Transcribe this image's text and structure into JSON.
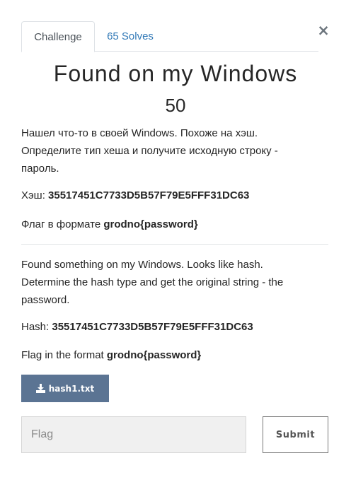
{
  "tabs": {
    "challenge": "Challenge",
    "solves": "65 Solves"
  },
  "close_glyph": "×",
  "challenge": {
    "title": "Found on my Windows",
    "value": "50"
  },
  "description_ru": {
    "text": "Нашел что-то в своей Windows. Похоже на хэш. Определите тип хеша и получите исходную строку - пароль.",
    "hash_label": "Хэш: ",
    "hash_value": "35517451C7733D5B57F79E5FFF31DC63",
    "flag_label": "Флаг в формате ",
    "flag_format": "grodno{password}"
  },
  "description_en": {
    "text": "Found something on my Windows. Looks like hash. Determine the hash type and get the original string - the password.",
    "hash_label": "Hash: ",
    "hash_value": "35517451C7733D5B57F79E5FFF31DC63",
    "flag_label": "Flag in the format ",
    "flag_format": "grodno{password}"
  },
  "file": {
    "name": "hash1.txt",
    "icon": "download-icon"
  },
  "submission": {
    "placeholder": "Flag",
    "value": "",
    "submit_label": "Submit"
  },
  "colors": {
    "file_button": "#5b7493",
    "tab_link": "#337ab7"
  }
}
